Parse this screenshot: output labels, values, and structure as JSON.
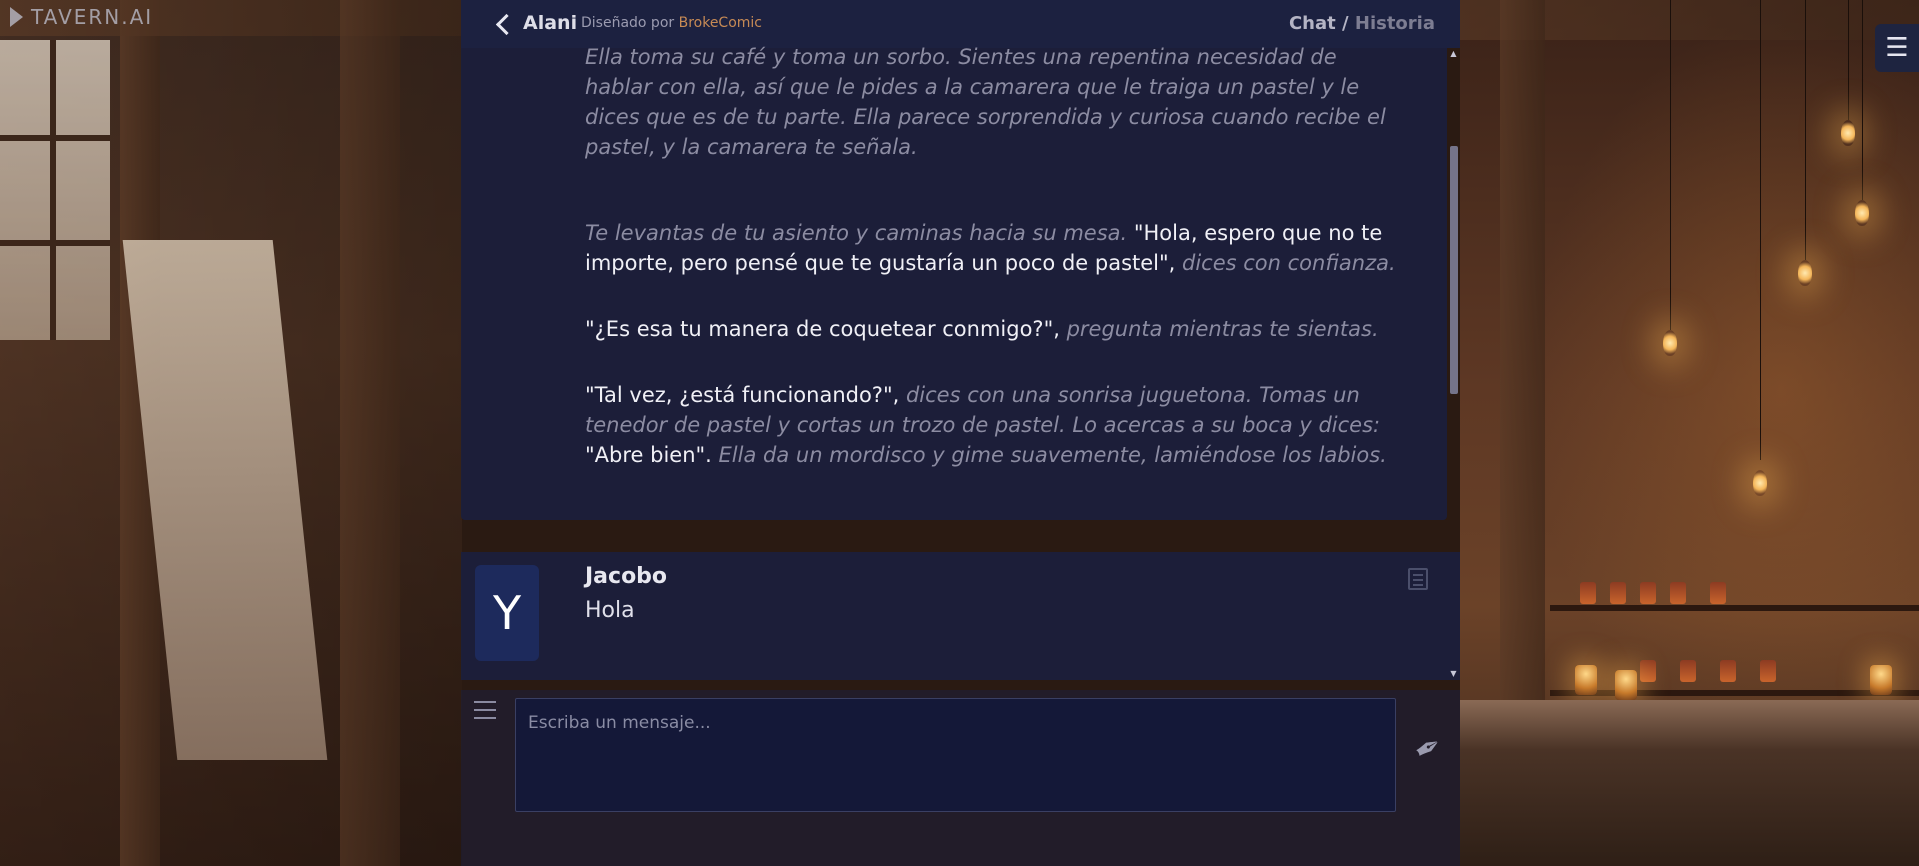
{
  "logo": {
    "text": "TAVERN.AI"
  },
  "menu": {
    "icon": "hamburger-icon",
    "glyph": "☰"
  },
  "header": {
    "back_icon": "chevron-left-icon",
    "character_name": "Alani",
    "designed_by_label": "Diseñado por",
    "author": "BrokeComic",
    "nav_chat": "Chat",
    "nav_separator": "/",
    "nav_history": "Historia"
  },
  "ai_message": {
    "paragraphs": [
      {
        "segments": [
          {
            "type": "narr",
            "text": "Ella toma su café y toma un sorbo. Sientes una repentina necesidad de hablar con ella, así que le pides a la camarera que le traiga un pastel y le dices que es de tu parte. Ella parece sorprendida y curiosa cuando recibe el pastel, y la camarera te señala."
          }
        ]
      },
      {
        "segments": [
          {
            "type": "narr",
            "text": "Te levantas de tu asiento y caminas hacia su mesa. "
          },
          {
            "type": "speech",
            "text": "\"Hola, espero que no te importe, pero pensé que te gustaría un poco de pastel\", "
          },
          {
            "type": "narr",
            "text": "dices con confianza."
          }
        ]
      },
      {
        "segments": [
          {
            "type": "speech",
            "text": "\"¿Es esa tu manera de coquetear conmigo?\", "
          },
          {
            "type": "narr",
            "text": "pregunta mientras te sientas."
          }
        ]
      },
      {
        "segments": [
          {
            "type": "speech",
            "text": "\"Tal vez, ¿está funcionando?\", "
          },
          {
            "type": "narr",
            "text": "dices con una sonrisa juguetona. Tomas un tenedor de pastel y cortas un trozo de pastel. Lo acercas a su boca y dices: "
          },
          {
            "type": "speech",
            "text": "\"Abre bien\". "
          },
          {
            "type": "narr",
            "text": "Ella da un mordisco y gime suavemente, lamiéndose los labios."
          }
        ]
      }
    ]
  },
  "user_message": {
    "avatar_letter": "Y",
    "name": "Jacobo",
    "text": "Hola",
    "edit_icon": "edit-icon"
  },
  "composer": {
    "options_icon": "options-icon",
    "placeholder": "Escriba un mensaje...",
    "value": "",
    "send_icon": "feather-icon",
    "send_glyph": "✒"
  }
}
